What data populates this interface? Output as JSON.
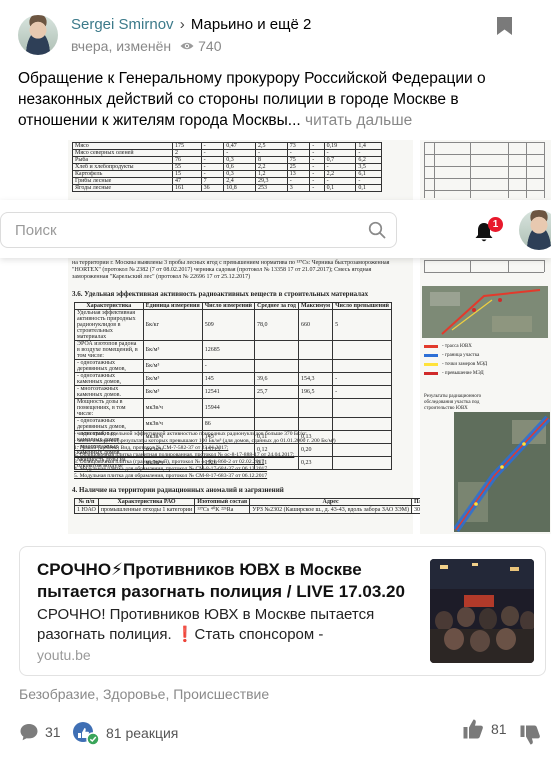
{
  "header": {
    "author": "Sergei Smirnov",
    "separator": "›",
    "channel": "Марьино и ещё 2",
    "timestamp": "вчера, изменён",
    "views": "740"
  },
  "post": {
    "text": "Обращение к Генеральному прокурору Российской Федерации о незаконных действий со стороны полиции в городе Москве в отношении к жителям города Москвы...",
    "read_more": "читать дальше"
  },
  "search": {
    "placeholder": "Поиск",
    "notification_count": "1"
  },
  "doc_left_top": {
    "rows": [
      [
        "Мясо",
        "175",
        "-",
        "0,47",
        "2,5",
        "73",
        "-",
        "0,19",
        "1,4"
      ],
      [
        "Мясо северных оленей",
        "2",
        "-",
        "-",
        "-",
        "-",
        "-",
        "-",
        "-"
      ],
      [
        "Рыба",
        "76",
        "-",
        "0,3",
        "8",
        "75",
        "-",
        "0,7",
        "6,2"
      ],
      [
        "Хлеб и хлебопродукты",
        "55",
        "-",
        "0,6",
        "2,2",
        "25",
        "-",
        "-",
        "3,5"
      ],
      [
        "Картофель",
        "15",
        "-",
        "0,3",
        "1,2",
        "13",
        "-",
        "2,2",
        "6,1"
      ],
      [
        "Грибы лесные",
        "47",
        "7",
        "2,4",
        "29,3",
        "-",
        "-",
        "-",
        "-"
      ],
      [
        "Ягоды лесные",
        "161",
        "36",
        "10,8",
        "253",
        "3",
        "-",
        "0,1",
        "0,1"
      ]
    ]
  },
  "doc_left_main": {
    "intro": "на территории г. Москвы выявлены 3 пробы лесных ягод с превышением норматива по ¹³⁷Cs: Черника быстрозамороженная \"HORTEX\" (протокол № 2382 (7 от 08.02.2017) черника садовая (протокол № 13358 17 от 21.07.2017); Смесь ягодная замороженная \"Карельский лес\" (протокол № 22696 17 от 25.12.2017)",
    "section_title": "3.6. Удельная эффективная активность радиоактивных веществ в строительных материалах",
    "table_headers": [
      "Характеристика",
      "Единица измерения",
      "Число измерений",
      "Среднее за год",
      "Максимум",
      "Число превышений"
    ],
    "table_rows": [
      [
        "Удельная эффективная активность природных радионуклидов в строительных материалах",
        "Бк/кг",
        "509",
        "78,0",
        "660",
        "5"
      ],
      [
        "ЭРОА изотопов радона в воздухе помещений, в том числе:",
        "Бк/м³",
        "12685",
        "",
        "",
        ""
      ],
      [
        "- одноэтажных деревянных домов,",
        "Бк/м³",
        "-",
        "",
        "",
        ""
      ],
      [
        "- одноэтажных каменных домов,",
        "Бк/м³",
        "145",
        "39,6",
        "154,3",
        "-"
      ],
      [
        "- многоэтажных каменных домов.",
        "Бк/м³",
        "12541",
        "25,7",
        "196,5",
        "-"
      ],
      [
        "Мощность дозы в помещениях, в том числе:",
        "мкЗв/ч",
        "15944",
        "",
        "",
        ""
      ],
      [
        "- одноэтажных деревянных домов,",
        "мкЗв/ч",
        "86",
        "",
        "",
        ""
      ],
      [
        "- одноэтажных каменных домов,",
        "мкЗв/ч",
        "145",
        "0,11",
        "0,13",
        ""
      ],
      [
        "- многоэтажных каменных домов.",
        "мкЗв/ч",
        "15713",
        "0,12",
        "0,20",
        ""
      ],
      [
        "Мощность дозы на открытом воздухе",
        "мкЗв/ч",
        "1926",
        "0,11",
        "0,23",
        ""
      ]
    ],
    "notes": [
      "- число проб, с удельной эффективной активностью природных радионуклидов больше 370 Бк/кг",
      "- число измерений, результаты которых превышают 100 Бк/м³ (для домов, сданных до 01.01.2000 г. 200 Бк/м³)",
      "1. Гравий (щебень) Вид, протокол № СМ-7-582-37 от 23.01.2017;",
      "2. Облицовочная плитка гранитная полированная, протокол № ос-8-17-888-17 от 24.04.2017;",
      "3. Облицовочная плитка (гранит серый), протокол № ос-8-1-860-2 от 02.02.2017",
      "4. Модульная плитка для обрамления, протокол № СМ-8-17-684-37 от 06.12.2017",
      "5. Модульная плитка для обрамления, протокол № СМ-8-17-683-37 от 06.12.2017"
    ],
    "section2_title": "4. Наличие на территории радиационных аномалий и загрязнений",
    "table2_headers": [
      "№ п/п",
      "Характеристика РАО",
      "Изотопный состав",
      "Адрес",
      "Площадь, м²",
      "Максимальная МЭД, мкЗв/ч"
    ],
    "table2_row": [
      "1 ЮАО",
      "промышленные отходы 1 категории",
      "¹³⁷Cs ⁴⁰K ²²⁶Ra",
      "УРЗ №2302 (Каширское ш., д. 43-43, вдоль забора ЗАО ЗЭМ)",
      "3000 м²",
      "5,41"
    ]
  },
  "doc_right": {
    "caption": "Результаты радиационного обследования участка под строительство ЮВХ",
    "legend": [
      "- трасса ЮВХ",
      "- граница участка",
      "- точки замеров МЭД",
      "- превышение МЭД"
    ]
  },
  "link_card": {
    "title": "СРОЧНО⚡Противников ЮВХ в Москве пытается разогнать полиция / LIVE 17.03.20",
    "description": "СРОЧНО! Противников ЮВХ в Москве пытается разогнать полиция. ❗Стать спонсором -",
    "domain": "youtu.be"
  },
  "tags": "Безобразие, Здоровье, Происшествие",
  "actions": {
    "comments": "31",
    "reactions": "81 реакция",
    "likes": "81"
  },
  "colors": {
    "author_link": "#3c7a8a",
    "meta_gray": "#888888",
    "badge_red": "#e8192c",
    "like_blue": "#3f6fb4"
  }
}
